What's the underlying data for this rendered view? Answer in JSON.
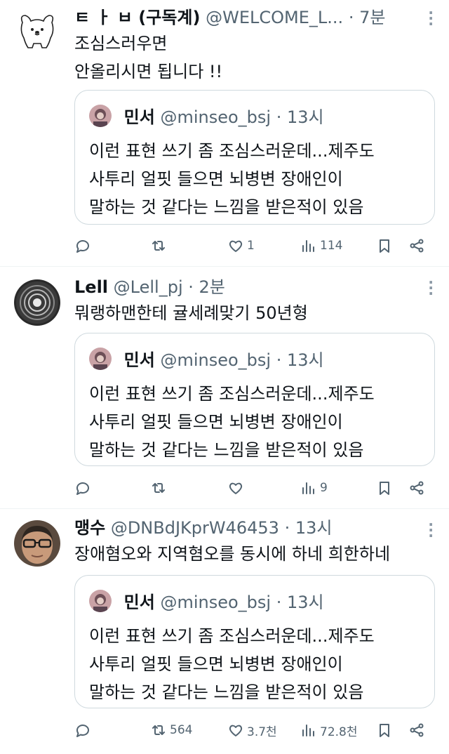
{
  "tweets": [
    {
      "author": "ㅌ ㅏ ㅂ (구독계)",
      "handle": "@WELCOME_L...",
      "time": "· 7분",
      "text": "조심스러우면\n안올리시면 됩니다 !!",
      "quote": {
        "author": "민서",
        "handle": "@minseo_bsj",
        "time": "· 13시",
        "text": "이런 표현 쓰기 좀 조심스러운데...제주도\n사투리 얼핏 들으면 뇌병변 장애인이\n말하는 것 같다는 느낌을 받은적이 있음"
      },
      "stats": {
        "replies": "",
        "retweets": "",
        "likes": "1",
        "views": "114"
      }
    },
    {
      "author": "Lell",
      "handle": "@Lell_pj",
      "time": "· 2분",
      "text": "뭐랭하맨한테 귤세례맞기 50년형",
      "quote": {
        "author": "민서",
        "handle": "@minseo_bsj",
        "time": "· 13시",
        "text": "이런 표현 쓰기 좀 조심스러운데...제주도\n사투리 얼핏 들으면 뇌병변 장애인이\n말하는 것 같다는 느낌을 받은적이 있음"
      },
      "stats": {
        "replies": "",
        "retweets": "",
        "likes": "",
        "views": "9"
      }
    },
    {
      "author": "맹수",
      "handle": "@DNBdJKprW46453",
      "time": "· 13시",
      "text": "장애혐오와 지역혐오를 동시에 하네 희한하네",
      "quote": {
        "author": "민서",
        "handle": "@minseo_bsj",
        "time": "· 13시",
        "text": "이런 표현 쓰기 좀 조심스러운데...제주도\n사투리 얼핏 들으면 뇌병변 장애인이\n말하는 것 같다는 느낌을 받은적이 있음"
      },
      "stats": {
        "replies": "",
        "retweets": "564",
        "likes": "3.7천",
        "views": "72.8천"
      }
    }
  ],
  "icons": {
    "reply": "reply-icon",
    "retweet": "retweet-icon",
    "like": "heart-icon",
    "views": "views-icon",
    "bookmark": "bookmark-icon",
    "share": "share-icon",
    "more": "more-vertical-icon"
  },
  "colors": {
    "text": "#0f1419",
    "muted": "#536471",
    "border": "#cfd9de",
    "divider": "#eff3f4"
  }
}
